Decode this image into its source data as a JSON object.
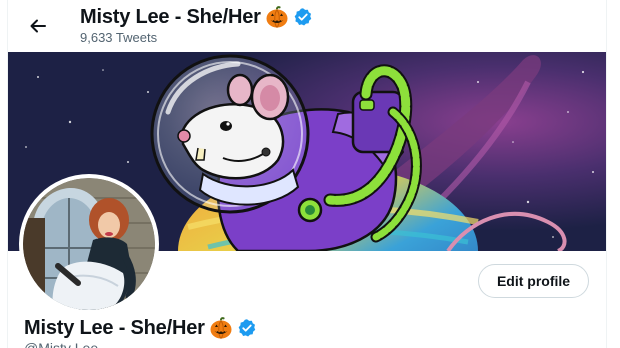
{
  "header": {
    "name": "Misty Lee - She/Her",
    "tweet_count": "9,633 Tweets",
    "back_icon": "back-arrow-icon"
  },
  "banner": {
    "description_icon": "astronaut-rat-illustration"
  },
  "profile": {
    "name": "Misty Lee - She/Her",
    "handle": "@Misty Lee",
    "edit_button_label": "Edit profile",
    "name_icons": [
      "pumpkin-icon",
      "verified-icon"
    ]
  },
  "colors": {
    "verified": "#1d9bf0",
    "pumpkin": "#f07d12",
    "text_primary": "#0f1419",
    "text_secondary": "#536471",
    "border": "#cfd9de",
    "banner_background": "#1d2145"
  }
}
